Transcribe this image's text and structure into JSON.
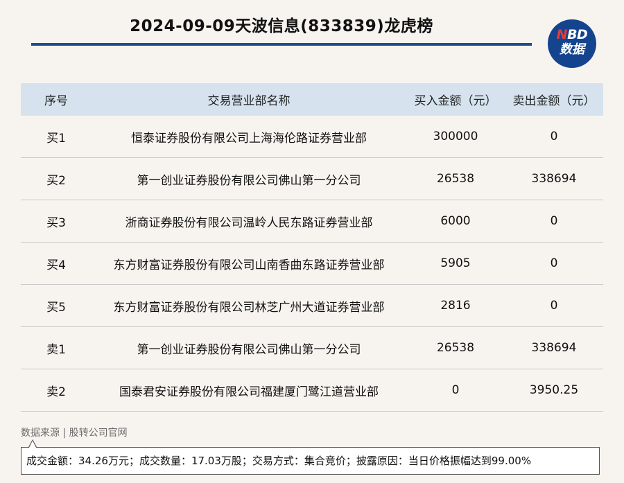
{
  "header": {
    "title": "2024-09-09天波信息(833839)龙虎榜"
  },
  "logo": {
    "line1_n": "N",
    "line1_rest": "BD",
    "line2": "数据",
    "color": "#15448f",
    "accent": "#e33b3b"
  },
  "table": {
    "headers": [
      "序号",
      "交易营业部名称",
      "买入金额（元）",
      "卖出金额（元）"
    ],
    "rows": [
      {
        "seq": "买1",
        "name": "恒泰证券股份有限公司上海海伦路证券营业部",
        "buy": "300000",
        "sell": "0"
      },
      {
        "seq": "买2",
        "name": "第一创业证券股份有限公司佛山第一分公司",
        "buy": "26538",
        "sell": "338694"
      },
      {
        "seq": "买3",
        "name": "浙商证券股份有限公司温岭人民东路证券营业部",
        "buy": "6000",
        "sell": "0"
      },
      {
        "seq": "买4",
        "name": "东方财富证券股份有限公司山南香曲东路证券营业部",
        "buy": "5905",
        "sell": "0"
      },
      {
        "seq": "买5",
        "name": "东方财富证券股份有限公司林芝广州大道证券营业部",
        "buy": "2816",
        "sell": "0"
      },
      {
        "seq": "卖1",
        "name": "第一创业证券股份有限公司佛山第一分公司",
        "buy": "26538",
        "sell": "338694"
      },
      {
        "seq": "卖2",
        "name": "国泰君安证券股份有限公司福建厦门鹭江道营业部",
        "buy": "0",
        "sell": "3950.25"
      }
    ]
  },
  "footer": {
    "source": "数据来源 | 股转公司官网",
    "note": "成交金额：34.26万元；成交数量：17.03万股；交易方式：集合竞价；披露原因：当日价格振幅达到99.00%"
  }
}
